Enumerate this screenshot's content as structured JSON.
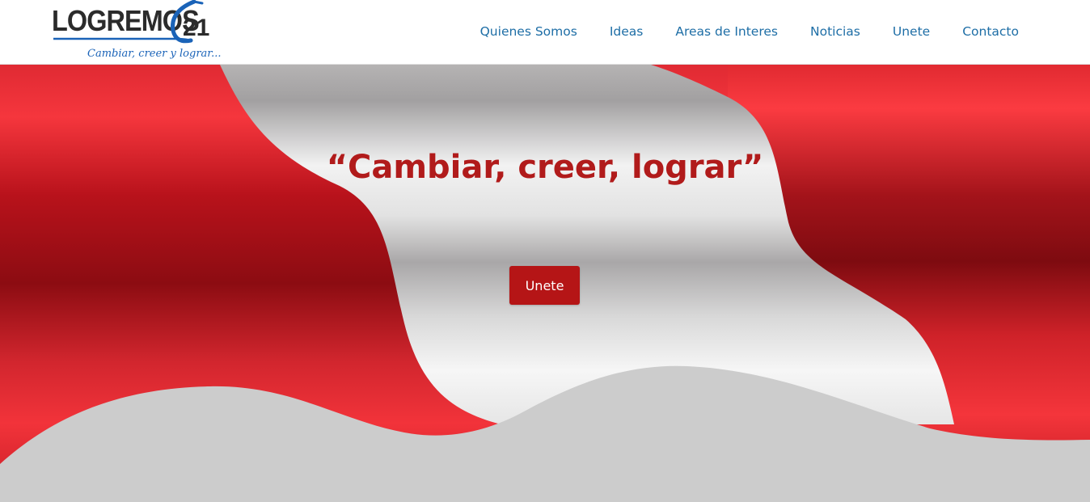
{
  "brand": {
    "name": "LOGREMOS",
    "number": "21",
    "tagline": "Cambiar, creer y lograr...",
    "colors": {
      "text": "#2b2b2b",
      "accent": "#1a63b8"
    }
  },
  "nav": {
    "items": [
      {
        "label": "Quienes Somos"
      },
      {
        "label": "Ideas"
      },
      {
        "label": "Areas de Interes"
      },
      {
        "label": "Noticias"
      },
      {
        "label": "Unete"
      },
      {
        "label": "Contacto"
      }
    ],
    "link_color": "#1e6ea6"
  },
  "hero": {
    "title": "“Cambiar, creer, lograr”",
    "button_label": "Unete",
    "colors": {
      "flag_red": "#d42a32",
      "flag_white": "#eeeeee",
      "title": "#b11b1b",
      "button": "#b51516",
      "wave": "#cccccc"
    }
  }
}
